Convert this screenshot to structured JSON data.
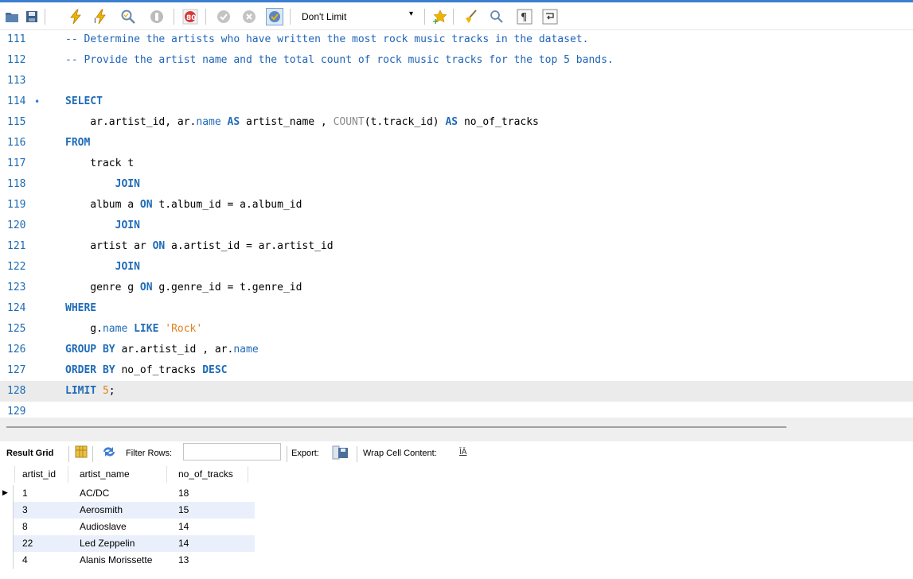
{
  "toolbar": {
    "limit_value": "Don't Limit"
  },
  "editor": {
    "lines": [
      {
        "no": "111",
        "code": "-- Determine the artists who have written the most rock music tracks in the dataset."
      },
      {
        "no": "112",
        "code": "-- Provide the artist name and the total count of rock music tracks for the top 5 bands."
      },
      {
        "no": "113",
        "code": ""
      },
      {
        "no": "114",
        "code": "SELECT"
      },
      {
        "no": "115",
        "code": "    ar.artist_id, ar.name AS artist_name , COUNT(t.track_id) AS no_of_tracks"
      },
      {
        "no": "116",
        "code": "FROM"
      },
      {
        "no": "117",
        "code": "    track t"
      },
      {
        "no": "118",
        "code": "        JOIN"
      },
      {
        "no": "119",
        "code": "    album a ON t.album_id = a.album_id"
      },
      {
        "no": "120",
        "code": "        JOIN"
      },
      {
        "no": "121",
        "code": "    artist ar ON a.artist_id = ar.artist_id"
      },
      {
        "no": "122",
        "code": "        JOIN"
      },
      {
        "no": "123",
        "code": "    genre g ON g.genre_id = t.genre_id"
      },
      {
        "no": "124",
        "code": "WHERE"
      },
      {
        "no": "125",
        "code": "    g.name LIKE 'Rock'"
      },
      {
        "no": "126",
        "code": "GROUP BY ar.artist_id , ar.name"
      },
      {
        "no": "127",
        "code": "ORDER BY no_of_tracks DESC"
      },
      {
        "no": "128",
        "code": "LIMIT 5;"
      },
      {
        "no": "129",
        "code": ""
      }
    ],
    "statement_marker": "•"
  },
  "result_toolbar": {
    "result_grid_label": "Result Grid",
    "filter_rows_label": "Filter Rows:",
    "filter_value": "",
    "export_label": "Export:",
    "wrap_label": "Wrap Cell Content:"
  },
  "grid": {
    "columns": [
      "artist_id",
      "artist_name",
      "no_of_tracks"
    ],
    "rows": [
      [
        "1",
        "AC/DC",
        "18"
      ],
      [
        "3",
        "Aerosmith",
        "15"
      ],
      [
        "8",
        "Audioslave",
        "14"
      ],
      [
        "22",
        "Led Zeppelin",
        "14"
      ],
      [
        "4",
        "Alanis Morissette",
        "13"
      ]
    ]
  },
  "colors": {
    "accent": "#3c7fd0",
    "keyword": "#1f6bb8",
    "string": "#e0821e",
    "selected_row_stripe": "#eaf0fb"
  }
}
